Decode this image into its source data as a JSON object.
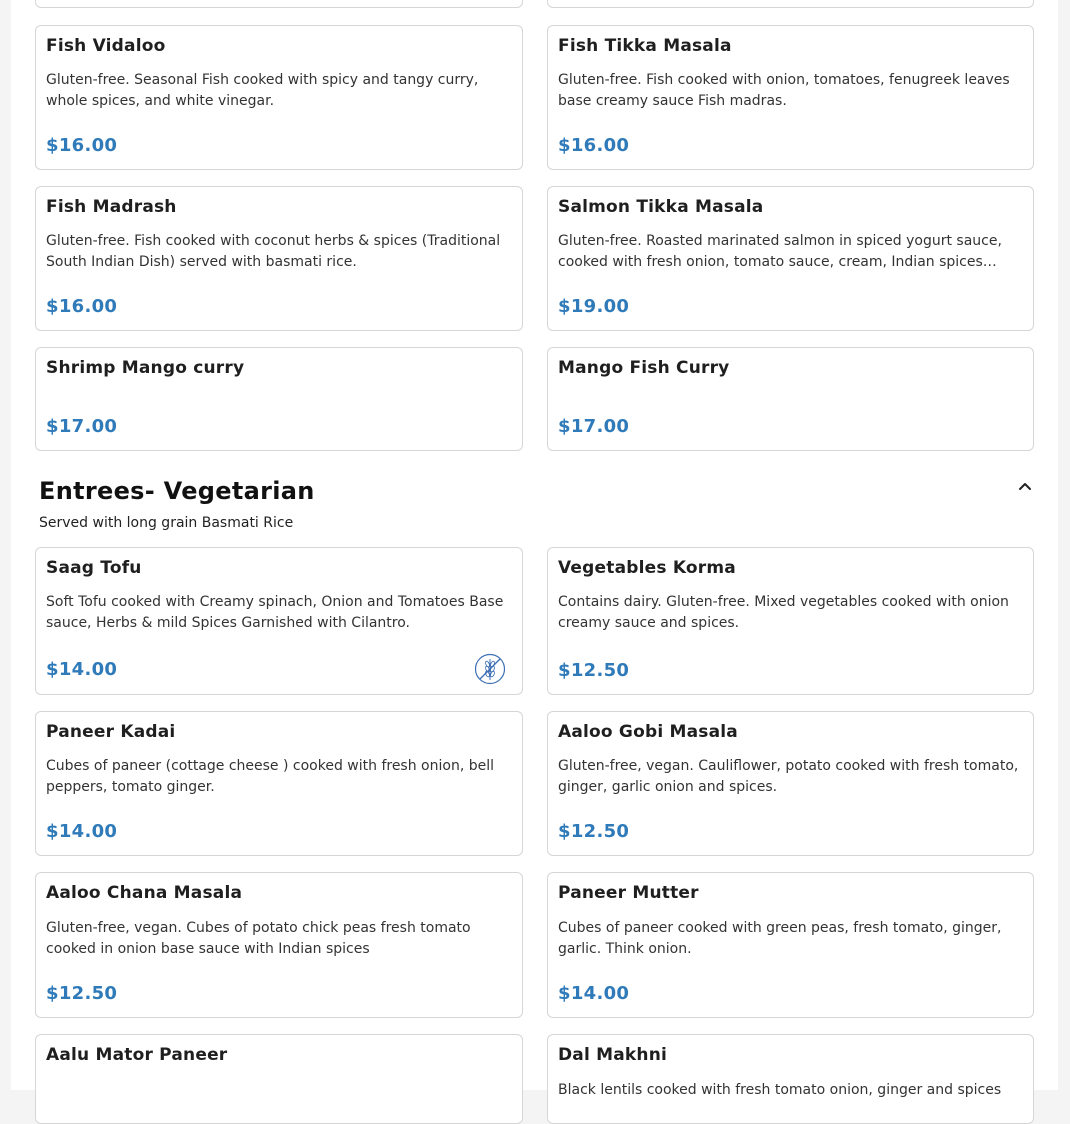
{
  "seafood_items": [
    {
      "name": "Fish Vidaloo",
      "description": "Gluten-free. Seasonal Fish cooked with spicy and tangy curry, whole spices, and white vinegar.",
      "price": "$16.00"
    },
    {
      "name": "Fish Tikka Masala",
      "description": "Gluten-free. Fish cooked with onion, tomatoes, fenugreek leaves base creamy sauce Fish madras.",
      "price": "$16.00"
    },
    {
      "name": "Fish Madrash",
      "description": "Gluten-free. Fish cooked with coconut herbs & spices (Traditional South Indian Dish) served with basmati rice.",
      "price": "$16.00"
    },
    {
      "name": "Salmon Tikka Masala",
      "description": "Gluten-free. Roasted marinated salmon in spiced yogurt sauce, cooked with fresh onion, tomato sauce, cream, Indian spices…",
      "price": "$19.00"
    },
    {
      "name": "Shrimp Mango curry",
      "description": "",
      "price": "$17.00"
    },
    {
      "name": "Mango Fish Curry",
      "description": "",
      "price": "$17.00"
    }
  ],
  "vegetarian_section": {
    "title": "Entrees- Vegetarian",
    "subtitle": "Served with long grain Basmati Rice",
    "collapse_icon": "chevron-up-icon",
    "items": [
      {
        "name": "Saag Tofu",
        "description": "Soft Tofu cooked with Creamy spinach, Onion and Tomatoes Base sauce, Herbs & mild Spices Garnished with Cilantro.",
        "price": "$14.00",
        "badge_icon": "gluten-free-icon"
      },
      {
        "name": "Vegetables Korma",
        "description": "Contains dairy. Gluten-free. Mixed vegetables cooked with onion creamy sauce and spices.",
        "price": "$12.50"
      },
      {
        "name": "Paneer Kadai",
        "description": "Cubes of paneer (cottage cheese ) cooked with fresh onion, bell peppers, tomato ginger.",
        "price": "$14.00"
      },
      {
        "name": "Aaloo Gobi Masala",
        "description": "Gluten-free, vegan. Cauliflower, potato cooked with fresh tomato, ginger, garlic onion and spices.",
        "price": "$12.50"
      },
      {
        "name": "Aaloo Chana Masala",
        "description": "Gluten-free, vegan. Cubes of potato chick peas fresh tomato cooked in onion base sauce with Indian spices",
        "price": "$12.50"
      },
      {
        "name": "Paneer Mutter",
        "description": "Cubes of paneer cooked with green peas, fresh tomato, ginger, garlic. Think onion.",
        "price": "$14.00"
      },
      {
        "name": "Aalu Mator Paneer",
        "description": "",
        "price": ""
      },
      {
        "name": "Dal Makhni",
        "description": "Black lentils cooked with fresh tomato onion, ginger and spices",
        "price": ""
      }
    ]
  },
  "colors": {
    "price": "#2f7ab9",
    "card_border": "#d6d6d6"
  }
}
